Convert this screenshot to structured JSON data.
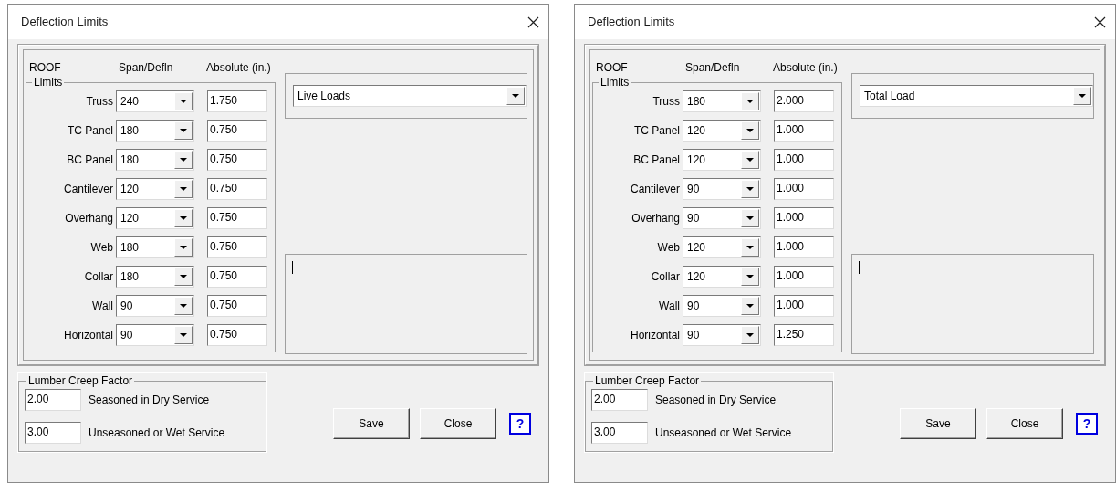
{
  "dialogs": [
    {
      "title": "Deflection Limits",
      "headers": {
        "roof": "ROOF",
        "span": "Span/Defln",
        "absolute": "Absolute (in.)"
      },
      "limits_legend": "Limits",
      "load_type": "Live Loads",
      "rows": [
        {
          "label": "Truss",
          "span": "240",
          "absolute": "1.750"
        },
        {
          "label": "TC Panel",
          "span": "180",
          "absolute": "0.750"
        },
        {
          "label": "BC Panel",
          "span": "180",
          "absolute": "0.750"
        },
        {
          "label": "Cantilever",
          "span": "120",
          "absolute": "0.750"
        },
        {
          "label": "Overhang",
          "span": "120",
          "absolute": "0.750"
        },
        {
          "label": "Web",
          "span": "180",
          "absolute": "0.750"
        },
        {
          "label": "Collar",
          "span": "180",
          "absolute": "0.750"
        },
        {
          "label": "Wall",
          "span": "90",
          "absolute": "0.750"
        },
        {
          "label": "Horizontal",
          "span": "90",
          "absolute": "0.750"
        }
      ],
      "creep": {
        "legend": "Lumber Creep Factor",
        "rows": [
          {
            "value": "2.00",
            "label": "Seasoned in Dry Service"
          },
          {
            "value": "3.00",
            "label": "Unseasoned or Wet Service"
          }
        ]
      },
      "buttons": [
        "Save",
        "Close"
      ],
      "help": "?"
    },
    {
      "title": "Deflection Limits",
      "headers": {
        "roof": "ROOF",
        "span": "Span/Defln",
        "absolute": "Absolute (in.)"
      },
      "limits_legend": "Limits",
      "load_type": "Total Load",
      "rows": [
        {
          "label": "Truss",
          "span": "180",
          "absolute": "2.000"
        },
        {
          "label": "TC Panel",
          "span": "120",
          "absolute": "1.000"
        },
        {
          "label": "BC Panel",
          "span": "120",
          "absolute": "1.000"
        },
        {
          "label": "Cantilever",
          "span": "90",
          "absolute": "1.000"
        },
        {
          "label": "Overhang",
          "span": "90",
          "absolute": "1.000"
        },
        {
          "label": "Web",
          "span": "120",
          "absolute": "1.000"
        },
        {
          "label": "Collar",
          "span": "120",
          "absolute": "1.000"
        },
        {
          "label": "Wall",
          "span": "90",
          "absolute": "1.000"
        },
        {
          "label": "Horizontal",
          "span": "90",
          "absolute": "1.250"
        }
      ],
      "creep": {
        "legend": "Lumber Creep Factor",
        "rows": [
          {
            "value": "2.00",
            "label": "Seasoned in Dry Service"
          },
          {
            "value": "3.00",
            "label": "Unseasoned or Wet Service"
          }
        ]
      },
      "buttons": [
        "Save",
        "Close"
      ],
      "help": "?"
    }
  ]
}
